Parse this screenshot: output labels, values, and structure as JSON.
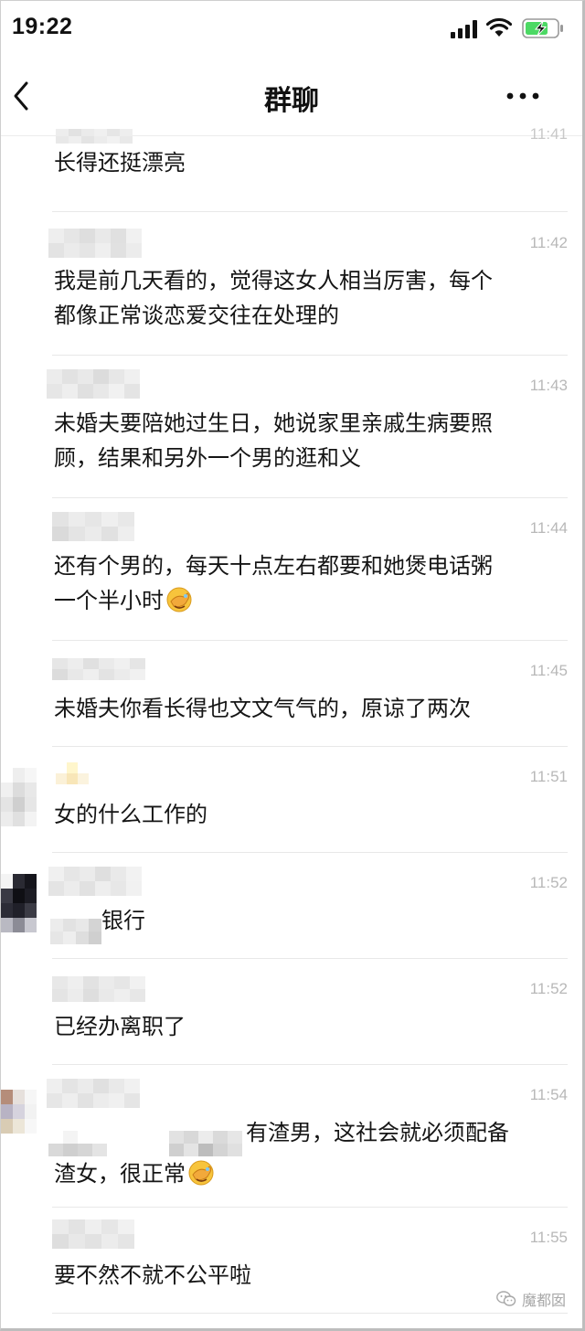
{
  "status_bar": {
    "time": "19:22"
  },
  "nav": {
    "title": "群聊"
  },
  "messages": [
    {
      "time": "11:41",
      "lines": [
        "长得还挺漂亮"
      ]
    },
    {
      "time": "11:42",
      "lines": [
        "我是前几天看的，觉得这女人相当厉害，每个",
        "都像正常谈恋爱交往在处理的"
      ]
    },
    {
      "time": "11:43",
      "lines": [
        "未婚夫要陪她过生日，她说家里亲戚生病要照",
        "顾，结果和另外一个男的逛和义"
      ]
    },
    {
      "time": "11:44",
      "lines": [
        "还有个男的，每天十点左右都要和她煲电话粥",
        "一个半小时"
      ]
    },
    {
      "time": "11:45",
      "lines": [
        "未婚夫你看长得也文文气气的，原谅了两次"
      ]
    },
    {
      "time": "11:51",
      "lines": [
        "女的什么工作的"
      ]
    },
    {
      "time": "11:52",
      "lines": [
        "银行"
      ]
    },
    {
      "time": "11:52",
      "lines": [
        "已经办离职了"
      ]
    },
    {
      "time": "11:54",
      "lines": [
        "有渣男，这社会就必须配备",
        "渣女，很正常"
      ]
    },
    {
      "time": "11:55",
      "lines": [
        "要不然不就不公平啦"
      ]
    }
  ],
  "watermark": {
    "text": "魔都囡"
  },
  "icons": {
    "back": "chevron-left-icon",
    "more": "more-dots-icon",
    "emoji": "facepalm-emoji-icon",
    "watermark": "wechat-logo-icon"
  }
}
